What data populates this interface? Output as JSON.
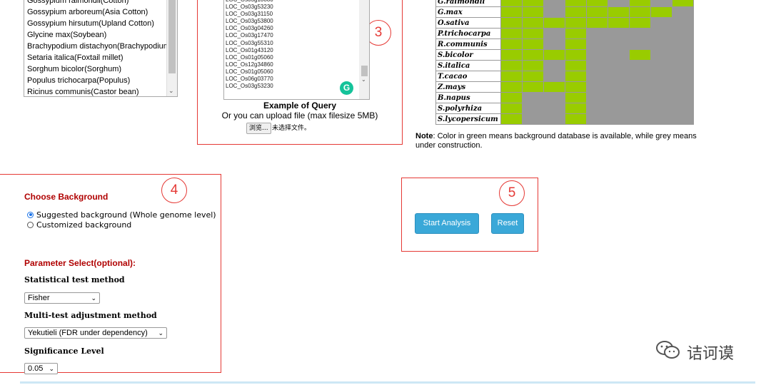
{
  "species_list": {
    "items": [
      "Gossypium raimondii(Cotton)",
      "Gossypium arboreum(Asia Cotton)",
      "Gossypium hirsutum(Upland Cotton)",
      "Glycine max(Soybean)",
      "Brachypodium distachyon(Brachypodium)",
      "Setaria italica(Foxtail millet)",
      "Sorghum bicolor(Sorghum)",
      "Populus trichocarpa(Populus)",
      "Ricinus communis(Castor bean)"
    ]
  },
  "query": {
    "lines": [
      "LOC_Os03g10880",
      "LOC_Os03g53230",
      "LOC_Os03g31150",
      "LOC_Os03g53800",
      "LOC_Os03g04260",
      "LOC_Os03g17470",
      "LOC_Os03g55310",
      "LOC_Os01g43120",
      "LOC_Os01g05060",
      "LOC_Os12g34860",
      "LOC_Os01g05060",
      "LOC_Os06g03770",
      "LOC_Os03g53230"
    ],
    "example_title": "Example of Query",
    "upload_text": "Or you can upload file (max filesize 5MB)",
    "browse_label": "浏览...",
    "no_file_label": "未选择文件。",
    "grammarly_label": "G"
  },
  "annotations": {
    "box3": "3",
    "box4": "4",
    "box5": "5"
  },
  "species_table": {
    "rows": [
      {
        "name": "G.raimondii",
        "cells": [
          "g",
          "g",
          "x",
          "g",
          "g",
          "x",
          "g",
          "x",
          "g"
        ]
      },
      {
        "name": "G.max",
        "cells": [
          "g",
          "g",
          "x",
          "g",
          "g",
          "g",
          "g",
          "g",
          "x"
        ]
      },
      {
        "name": "O.sativa",
        "cells": [
          "g",
          "g",
          "g",
          "g",
          "g",
          "g",
          "g",
          "x",
          "x"
        ]
      },
      {
        "name": "P.trichocarpa",
        "cells": [
          "g",
          "g",
          "x",
          "g",
          "x",
          "x",
          "x",
          "x",
          "x"
        ]
      },
      {
        "name": "R.communis",
        "cells": [
          "g",
          "g",
          "x",
          "g",
          "x",
          "x",
          "x",
          "x",
          "x"
        ]
      },
      {
        "name": "S.bicolor",
        "cells": [
          "g",
          "g",
          "g",
          "g",
          "x",
          "x",
          "g",
          "x",
          "x"
        ]
      },
      {
        "name": "S.italica",
        "cells": [
          "g",
          "g",
          "x",
          "g",
          "x",
          "x",
          "x",
          "x",
          "x"
        ]
      },
      {
        "name": "T.cacao",
        "cells": [
          "g",
          "g",
          "x",
          "g",
          "x",
          "x",
          "x",
          "x",
          "x"
        ]
      },
      {
        "name": "Z.mays",
        "cells": [
          "g",
          "g",
          "g",
          "g",
          "x",
          "x",
          "x",
          "x",
          "x"
        ]
      },
      {
        "name": "B.napus",
        "cells": [
          "g",
          "x",
          "x",
          "g",
          "x",
          "x",
          "x",
          "x",
          "x"
        ]
      },
      {
        "name": "S.polyrhiza",
        "cells": [
          "g",
          "x",
          "x",
          "g",
          "x",
          "x",
          "x",
          "x",
          "x"
        ]
      },
      {
        "name": "S.lycopersicum",
        "cells": [
          "g",
          "x",
          "x",
          "g",
          "x",
          "x",
          "x",
          "x",
          "x"
        ]
      }
    ],
    "colors": {
      "available": "#99cc00",
      "under_construction": "#999999"
    }
  },
  "note": {
    "label": "Note",
    "text": ": Color in green means background database is available, while grey means under construction."
  },
  "background": {
    "title": "Choose Background",
    "options": [
      {
        "label": "Suggested background (Whole genome level)",
        "checked": true
      },
      {
        "label": "Customized background",
        "checked": false
      }
    ]
  },
  "params": {
    "title": "Parameter Select(optional):",
    "stat_label": "Statistical test method",
    "stat_value": "Fisher",
    "multi_label": "Multi-test adjustment method",
    "multi_value": "Yekutieli (FDR under dependency)",
    "sig_label": "Significance Level",
    "sig_value": "0.05"
  },
  "actions": {
    "start_label": "Start Analysis",
    "reset_label": "Reset"
  },
  "watermark": {
    "text": "诘诃谟"
  }
}
